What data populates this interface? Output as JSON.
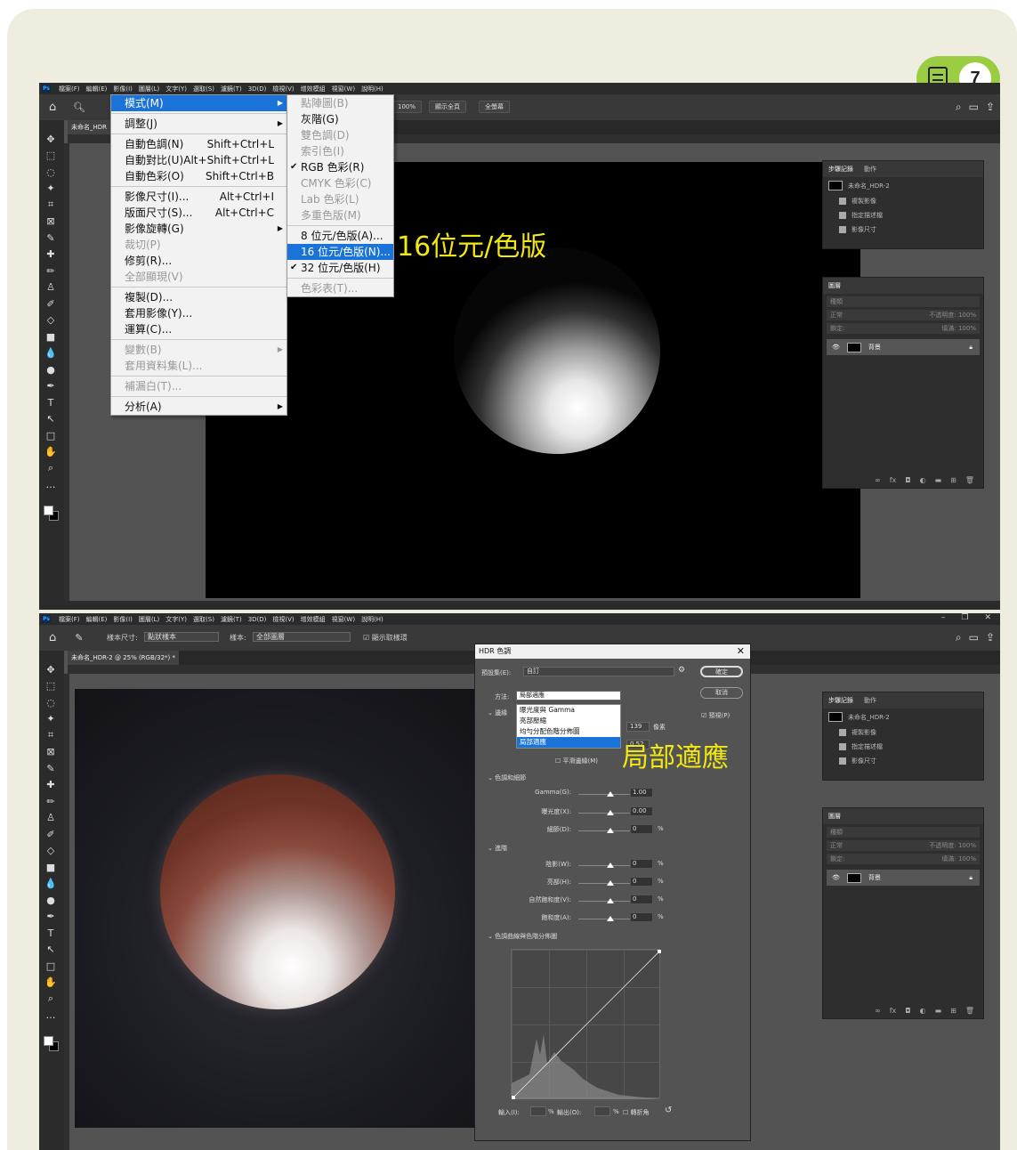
{
  "badge": {
    "number": "7"
  },
  "annotations": {
    "top": "16位元/色版",
    "bottom": "局部適應"
  },
  "top_window": {
    "menubar": [
      "檔案(F)",
      "編輯(E)",
      "影像(I)",
      "圖層(L)",
      "文字(Y)",
      "選取(S)",
      "濾鏡(T)",
      "3D(D)",
      "檢視(V)",
      "增效模組",
      "視窗(W)",
      "說明(H)"
    ],
    "zoom_btn": "100%",
    "fit_btn": "顯示全頁",
    "fill_btn": "全螢幕",
    "tab_title": "未命名_HDR",
    "image_menu": [
      {
        "label": "模式(M)",
        "sub": true,
        "hl": true
      },
      {
        "sep": true
      },
      {
        "label": "調整(J)",
        "sub": true
      },
      {
        "sep": true
      },
      {
        "label": "自動色調(N)",
        "shortcut": "Shift+Ctrl+L"
      },
      {
        "label": "自動對比(U)",
        "shortcut": "Alt+Shift+Ctrl+L"
      },
      {
        "label": "自動色彩(O)",
        "shortcut": "Shift+Ctrl+B"
      },
      {
        "sep": true
      },
      {
        "label": "影像尺寸(I)...",
        "shortcut": "Alt+Ctrl+I"
      },
      {
        "label": "版面尺寸(S)...",
        "shortcut": "Alt+Ctrl+C"
      },
      {
        "label": "影像旋轉(G)",
        "sub": true
      },
      {
        "label": "裁切(P)",
        "dis": true
      },
      {
        "label": "修剪(R)..."
      },
      {
        "label": "全部顯現(V)",
        "dis": true
      },
      {
        "sep": true
      },
      {
        "label": "複製(D)..."
      },
      {
        "label": "套用影像(Y)..."
      },
      {
        "label": "運算(C)..."
      },
      {
        "sep": true
      },
      {
        "label": "變數(B)",
        "sub": true,
        "dis": true
      },
      {
        "label": "套用資料集(L)...",
        "dis": true
      },
      {
        "sep": true
      },
      {
        "label": "補漏白(T)...",
        "dis": true
      },
      {
        "sep": true
      },
      {
        "label": "分析(A)",
        "sub": true
      }
    ],
    "mode_menu": [
      {
        "label": "點陣圖(B)",
        "dis": true
      },
      {
        "label": "灰階(G)"
      },
      {
        "label": "雙色調(D)",
        "dis": true
      },
      {
        "label": "索引色(I)",
        "dis": true
      },
      {
        "label": "RGB 色彩(R)",
        "check": true
      },
      {
        "label": "CMYK 色彩(C)",
        "dis": true
      },
      {
        "label": "Lab 色彩(L)",
        "dis": true
      },
      {
        "label": "多重色版(M)",
        "dis": true
      },
      {
        "sep": true
      },
      {
        "label": "8 位元/色版(A)..."
      },
      {
        "label": "16 位元/色版(N)...",
        "hl": true
      },
      {
        "label": "32 位元/色版(H)",
        "check": true
      },
      {
        "sep": true
      },
      {
        "label": "色彩表(T)...",
        "dis": true
      }
    ],
    "history_panel": {
      "tabs": [
        "步驟記錄",
        "動作"
      ],
      "snapshot": "未命名_HDR-2",
      "items": [
        "複製影像",
        "指定描述檔",
        "影像尺寸"
      ]
    },
    "layers_panel": {
      "tab": "圖層",
      "kind": "種類",
      "blend": "正常",
      "opacity": "不透明度: 100%",
      "lock": "鎖定:",
      "fill": "填滿: 100%",
      "layer": "背景"
    }
  },
  "bottom_window": {
    "menubar": [
      "檔案(F)",
      "編輯(E)",
      "影像(I)",
      "圖層(L)",
      "文字(Y)",
      "選取(S)",
      "濾鏡(T)",
      "3D(D)",
      "檢視(V)",
      "增效模組",
      "視窗(W)",
      "說明(H)"
    ],
    "sample_size_label": "樣本尺寸:",
    "sample_size_value": "點狀樣本",
    "sample_label": "樣本:",
    "sample_value": "全部圖層",
    "show_ring": "顯示取樣環",
    "tab_title": "未命名_HDR-2 @ 25% (RGB/32*) *",
    "history_panel": {
      "tabs": [
        "步驟記錄",
        "動作"
      ],
      "snapshot": "未命名_HDR-2",
      "items": [
        "複製影像",
        "指定描述檔",
        "影像尺寸"
      ]
    },
    "layers_panel": {
      "tab": "圖層",
      "kind": "種類",
      "blend": "正常",
      "opacity": "不透明度: 100%",
      "lock": "鎖定:",
      "fill": "填滿: 100%",
      "layer": "背景"
    }
  },
  "hdr_dialog": {
    "title": "HDR 色調",
    "preset_label": "預設集(E):",
    "preset_value": "自訂",
    "ok": "確定",
    "cancel": "取消",
    "preview": "預視(P)",
    "method_label": "方法:",
    "method_value": "局部適應",
    "method_options": [
      "曝光度與 Gamma",
      "亮部壓縮",
      "均勻分配色階分佈圖",
      "局部適應"
    ],
    "edge_section": "邊緣",
    "radius_value": "139",
    "radius_unit": "像素",
    "strength_value": "0.52",
    "smooth_edges": "平滑邊緣(M)",
    "tone_section": "色調和細節",
    "gamma_label": "Gamma(G):",
    "gamma_value": "1.00",
    "exposure_label": "曝光度(X):",
    "exposure_value": "0.00",
    "detail_label": "細節(D):",
    "detail_value": "0",
    "advanced_section": "進階",
    "shadow_label": "陰影(W):",
    "shadow_value": "0",
    "highlight_label": "亮部(H):",
    "highlight_value": "0",
    "vibrance_label": "自然飽和度(V):",
    "vibrance_value": "0",
    "saturation_label": "飽和度(A):",
    "saturation_value": "0",
    "curve_section": "色調曲線與色階分佈圖",
    "input_label": "輸入(I):",
    "output_label": "輸出(O):",
    "percent": "%",
    "corner_label": "轉折角"
  }
}
